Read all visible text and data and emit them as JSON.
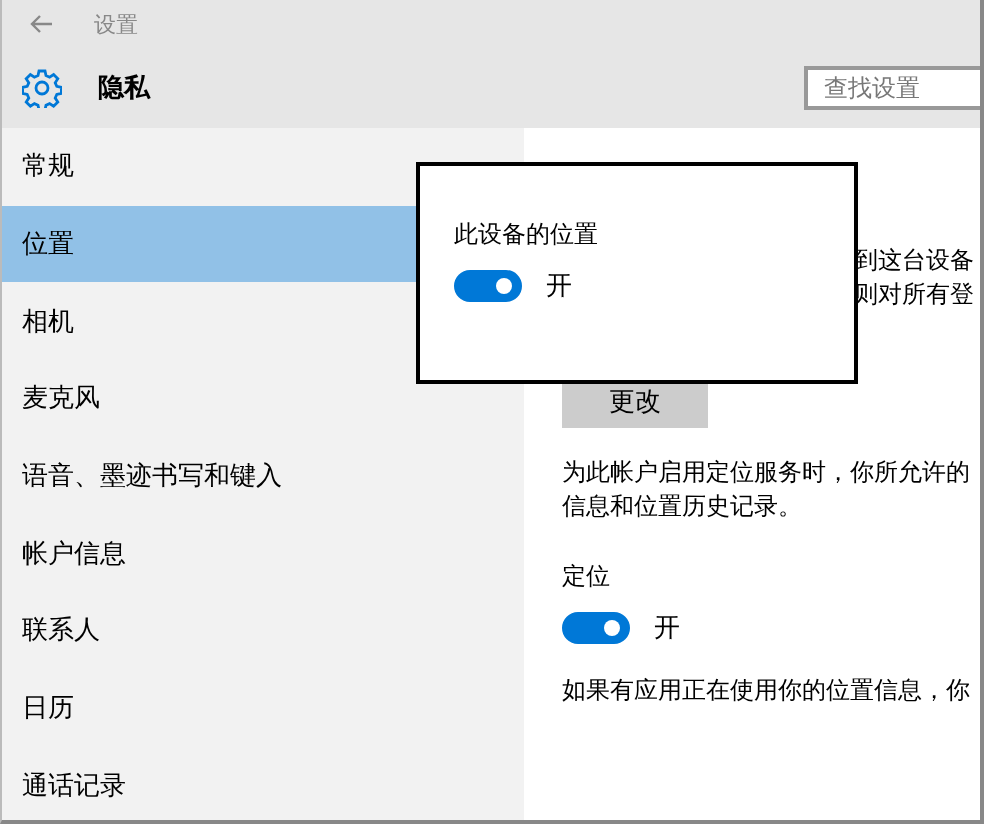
{
  "window": {
    "title": "设置"
  },
  "header": {
    "title": "隐私",
    "search": {
      "placeholder": "查找设置"
    }
  },
  "sidebar": {
    "items": [
      {
        "label": "常规",
        "selected": false
      },
      {
        "label": "位置",
        "selected": true
      },
      {
        "label": "相机",
        "selected": false
      },
      {
        "label": "麦克风",
        "selected": false
      },
      {
        "label": "语音、墨迹书写和键入",
        "selected": false
      },
      {
        "label": "帐户信息",
        "selected": false
      },
      {
        "label": "联系人",
        "selected": false
      },
      {
        "label": "日历",
        "selected": false
      },
      {
        "label": "通话记录",
        "selected": false
      }
    ]
  },
  "content": {
    "partial_lines": [
      "到这台设备",
      "则对所有登"
    ],
    "button": "更改",
    "paragraph": [
      "为此帐户启用定位服务时，你所允许的",
      "信息和位置历史记录。"
    ],
    "location": {
      "label": "定位",
      "toggle": {
        "on": true,
        "label": "开"
      }
    },
    "note": "如果有应用正在使用你的位置信息，你"
  },
  "callout": {
    "title": "此设备的位置",
    "toggle": {
      "on": true,
      "label": "开"
    }
  }
}
